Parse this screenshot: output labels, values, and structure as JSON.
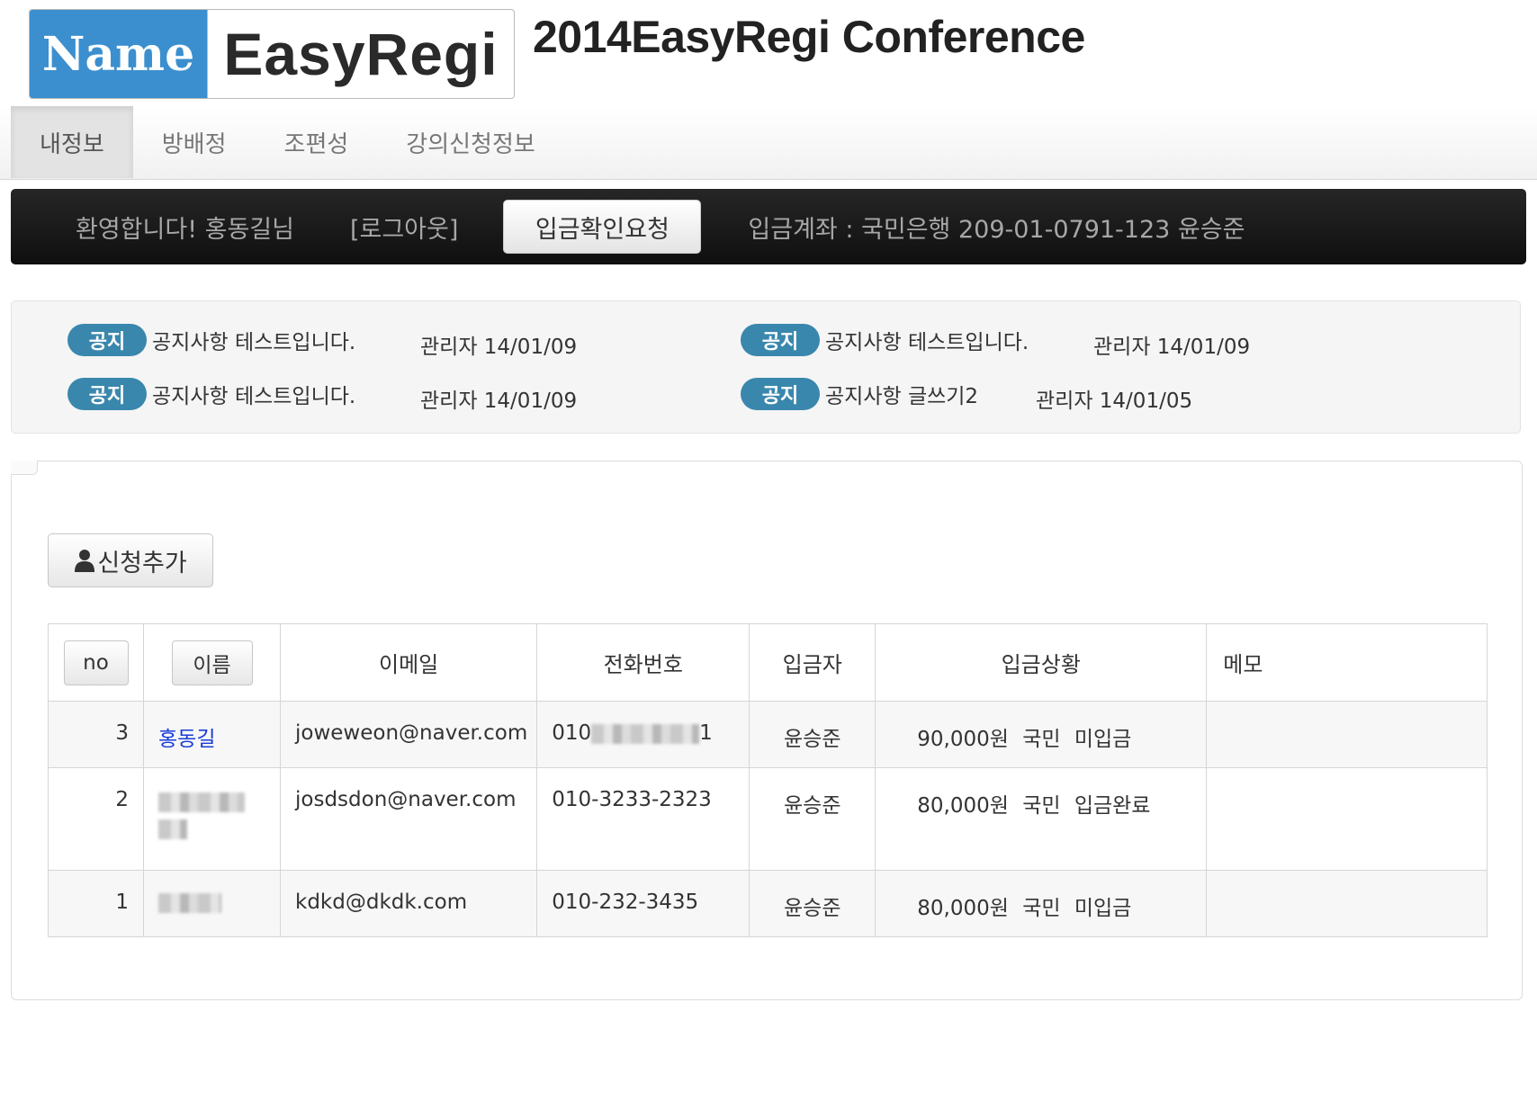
{
  "header": {
    "logo_left": "Name",
    "logo_right": "EasyRegi",
    "title": "2014EasyRegi Conference"
  },
  "nav": {
    "items": [
      {
        "label": "내정보",
        "active": true
      },
      {
        "label": "방배정",
        "active": false
      },
      {
        "label": "조편성",
        "active": false
      },
      {
        "label": "강의신청정보",
        "active": false
      }
    ]
  },
  "userbar": {
    "welcome": "환영합니다! 홍동길님",
    "logout": "[로그아웃]",
    "deposit_button": "입금확인요청",
    "account_info": "입금계좌 : 국민은행 209-01-0791-123 윤승준"
  },
  "notices": [
    {
      "badge": "공지",
      "title": "공지사항 테스트입니다.",
      "meta": "관리자 14/01/09"
    },
    {
      "badge": "공지",
      "title": "공지사항 테스트입니다.",
      "meta": "관리자 14/01/09"
    },
    {
      "badge": "공지",
      "title": "공지사항 테스트입니다.",
      "meta": "관리자 14/01/09"
    },
    {
      "badge": "공지",
      "title": "공지사항 글쓰기2",
      "meta": "관리자 14/01/05"
    }
  ],
  "main": {
    "add_button": "신청추가",
    "table": {
      "headers": {
        "no": "no",
        "name": "이름",
        "email": "이메일",
        "phone": "전화번호",
        "depositor": "입금자",
        "status": "입금상황",
        "memo": "메모"
      },
      "rows": [
        {
          "no": "3",
          "name": "홍동길",
          "email": "joweweon@naver.com",
          "phone_prefix": "010",
          "phone_suffix": "1",
          "depositor": "윤승준",
          "status": "90,000원 국민 미입금",
          "memo": ""
        },
        {
          "no": "2",
          "name": "",
          "email": "josdsdon@naver.com",
          "phone": "010-3233-2323",
          "depositor": "윤승준",
          "status": "80,000원 국민 입금완료",
          "memo": ""
        },
        {
          "no": "1",
          "name": "",
          "email": "kdkd@dkdk.com",
          "phone": "010-232-3435",
          "depositor": "윤승준",
          "status": "80,000원 국민 미입금",
          "memo": ""
        }
      ]
    }
  },
  "colors": {
    "badge": "#3a87ad",
    "logo_blue": "#3b8fcf",
    "link": "#1a3cd8"
  }
}
